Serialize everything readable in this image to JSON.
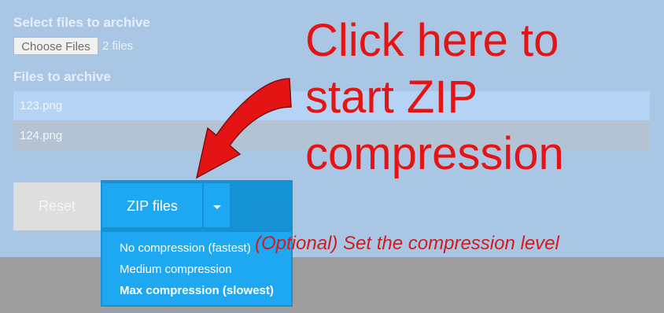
{
  "select_label": "Select files to archive",
  "choose_files": {
    "button_label": "Choose Files",
    "count_text": "2 files"
  },
  "files_label": "Files to archive",
  "files": [
    "123.png",
    "124.png"
  ],
  "actions": {
    "reset_label": "Reset",
    "zip_label": "ZIP files"
  },
  "compression_options": [
    {
      "label": "No compression (fastest)"
    },
    {
      "label": "Medium compression"
    },
    {
      "label": "Max compression (slowest)"
    }
  ],
  "callout": {
    "text": "Click here to\nstart ZIP\ncompression",
    "note": "(Optional) Set the compression level"
  },
  "colors": {
    "accent": "#1ea8f2",
    "callout_red": "#e41414",
    "background": "#a9c7e5"
  },
  "icons": {
    "caret": "caret-down-icon",
    "pointer": "curved-arrow-icon"
  }
}
